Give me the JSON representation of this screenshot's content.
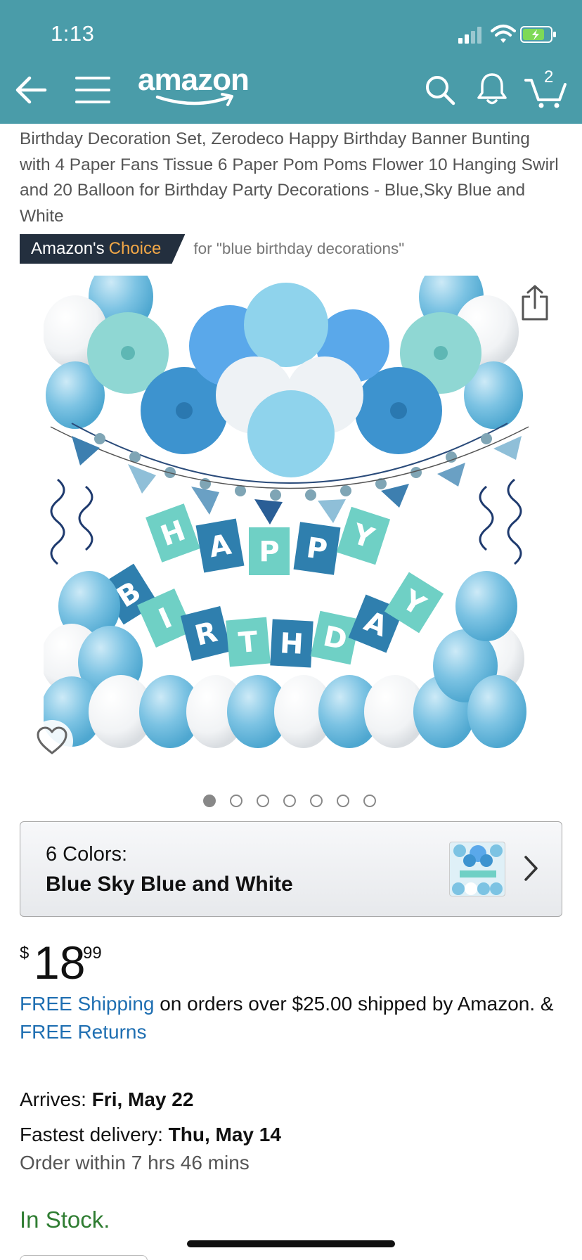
{
  "status_bar": {
    "time": "1:13"
  },
  "header": {
    "logo_text": "amazon",
    "cart_count": "2",
    "bg_color": "#4a9ca9"
  },
  "product": {
    "title": "Birthday Decoration Set, Zerodeco Happy Birthday Banner Bunting with 4 Paper Fans Tissue 6 Paper Pom Poms Flower 10 Hanging Swirl and 20 Balloon for Birthday Party Decorations - Blue,Sky Blue and White",
    "choice_badge": {
      "prefix": "Amazon's",
      "highlight": "Choice",
      "context": "for \"blue birthday decorations\""
    },
    "image_banner_letters": [
      "H",
      "A",
      "P",
      "P",
      "Y",
      "B",
      "I",
      "R",
      "T",
      "H",
      "D",
      "A",
      "Y"
    ],
    "image_count": 7,
    "active_image_index": 0
  },
  "variation": {
    "label": "6 Colors:",
    "value": "Blue Sky Blue and White"
  },
  "price": {
    "currency": "$",
    "whole": "18",
    "fraction": "99"
  },
  "shipping": {
    "free_shipping": "FREE Shipping",
    "middle": " on orders over $25.00 shipped by Amazon. & ",
    "free_returns": "FREE Returns"
  },
  "delivery": {
    "arrives_label": "Arrives: ",
    "arrives_date": "Fri, May 22",
    "fastest_label": "Fastest delivery: ",
    "fastest_date": "Thu, May 14",
    "order_within": "Order within 7 hrs 46 mins"
  },
  "stock": "In Stock.",
  "colors": {
    "link": "#1f6fb2",
    "in_stock": "#2f7d32",
    "choice_badge": "#232f3e",
    "choice_accent": "#f3a847"
  }
}
